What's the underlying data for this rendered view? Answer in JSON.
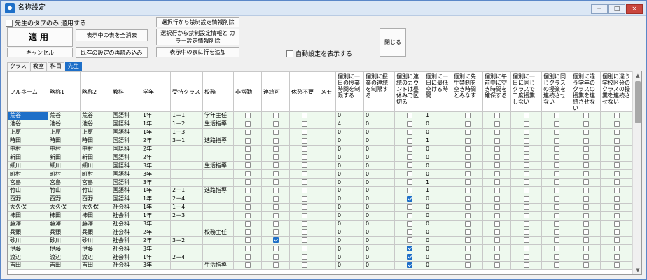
{
  "window": {
    "title": "名称設定",
    "app_icon": "app-icon",
    "minimize": "─",
    "maximize": "□",
    "close": "×"
  },
  "controls": {
    "apply_other_tabs": "先生のタブのみ 適用する",
    "apply": "適用",
    "cancel": "キャンセル",
    "clear_table": "表示中の表を全消去",
    "reload_settings": "既存の設定の再読み込み",
    "delete_restriction": "選択行から禁制設定情報削除",
    "delete_restriction_color": "選択行から禁制設定情報と カラー設定情報削除",
    "add_row": "表示中の表に行を追加",
    "auto_settings": "自動設定を表示する",
    "close": "閉じる"
  },
  "tabs": [
    {
      "label": "クラス",
      "active": false
    },
    {
      "label": "教室",
      "active": false
    },
    {
      "label": "科目",
      "active": false
    },
    {
      "label": "先生",
      "active": true
    }
  ],
  "columns": [
    "フルネーム",
    "略称1",
    "略称2",
    "教科",
    "学年",
    "受持クラス",
    "校務",
    "非常勤",
    "連続可",
    "休憩不要",
    "メモ",
    "個別に一日の授業時間を制限する",
    "個別に授業の連続を制限する",
    "個別に連続のカウントは昼休みで区切る",
    "個別に一日に最低空ける時間",
    "個別に先生禁制を空き時間とみなす",
    "個別に午前中に空き時間を確保する",
    "個別に一日に同じクラスで二度授業しない",
    "個別に同じクラスの授業を連続させない",
    "個別に違う学年のクラスの授業を連続させない",
    "個別に違う学校区分のクラスの授業を連続させない"
  ],
  "rows": [
    {
      "fullname": "荒谷",
      "short1": "荒谷",
      "short2": "荒谷",
      "subject": "国語科",
      "grade": "1年",
      "class": "1－1",
      "duty": "学年主任",
      "c1": "0",
      "c2": "0",
      "c4": "1",
      "parttime": false,
      "consec": false,
      "nobreak": false,
      "lunch": false
    },
    {
      "fullname": "池谷",
      "short1": "池谷",
      "short2": "池谷",
      "subject": "国語科",
      "grade": "1年",
      "class": "1－2",
      "duty": "生活指導",
      "c1": "4",
      "c2": "0",
      "c4": "0",
      "parttime": false,
      "consec": false,
      "nobreak": false,
      "lunch": false
    },
    {
      "fullname": "上原",
      "short1": "上原",
      "short2": "上原",
      "subject": "国語科",
      "grade": "1年",
      "class": "1－3",
      "duty": "",
      "c1": "0",
      "c2": "0",
      "c4": "0",
      "parttime": false,
      "consec": false,
      "nobreak": false,
      "lunch": false
    },
    {
      "fullname": "時田",
      "short1": "時田",
      "short2": "時田",
      "subject": "国語科",
      "grade": "2年",
      "class": "3－1",
      "duty": "進路指導",
      "c1": "0",
      "c2": "0",
      "c4": "1",
      "parttime": false,
      "consec": false,
      "nobreak": false,
      "lunch": false
    },
    {
      "fullname": "中村",
      "short1": "中村",
      "short2": "中村",
      "subject": "国語科",
      "grade": "2年",
      "class": "",
      "duty": "",
      "c1": "0",
      "c2": "0",
      "c4": "0",
      "parttime": false,
      "consec": false,
      "nobreak": false,
      "lunch": false
    },
    {
      "fullname": "新田",
      "short1": "新田",
      "short2": "新田",
      "subject": "国語科",
      "grade": "2年",
      "class": "",
      "duty": "",
      "c1": "0",
      "c2": "0",
      "c4": "0",
      "parttime": false,
      "consec": false,
      "nobreak": false,
      "lunch": false
    },
    {
      "fullname": "細川",
      "short1": "細川",
      "short2": "細川",
      "subject": "国語科",
      "grade": "3年",
      "class": "",
      "duty": "生活指導",
      "c1": "0",
      "c2": "0",
      "c4": "0",
      "parttime": false,
      "consec": false,
      "nobreak": false,
      "lunch": false
    },
    {
      "fullname": "町村",
      "short1": "町村",
      "short2": "町村",
      "subject": "国語科",
      "grade": "3年",
      "class": "",
      "duty": "",
      "c1": "0",
      "c2": "0",
      "c4": "0",
      "parttime": false,
      "consec": false,
      "nobreak": false,
      "lunch": false
    },
    {
      "fullname": "宮島",
      "short1": "宮島",
      "short2": "宮島",
      "subject": "国語科",
      "grade": "3年",
      "class": "",
      "duty": "",
      "c1": "0",
      "c2": "0",
      "c4": "1",
      "parttime": false,
      "consec": false,
      "nobreak": false,
      "lunch": false
    },
    {
      "fullname": "竹山",
      "short1": "竹山",
      "short2": "竹山",
      "subject": "国語科",
      "grade": "1年",
      "class": "2－1",
      "duty": "進路指導",
      "c1": "0",
      "c2": "0",
      "c4": "1",
      "parttime": false,
      "consec": false,
      "nobreak": false,
      "lunch": false
    },
    {
      "fullname": "西野",
      "short1": "西野",
      "short2": "西野",
      "subject": "国語科",
      "grade": "1年",
      "class": "2－4",
      "duty": "",
      "c1": "0",
      "c2": "0",
      "c4": "0",
      "parttime": false,
      "consec": false,
      "nobreak": false,
      "lunch": true
    },
    {
      "fullname": "大久保",
      "short1": "大久保",
      "short2": "大久保",
      "subject": "社会科",
      "grade": "1年",
      "class": "1－4",
      "duty": "",
      "c1": "0",
      "c2": "0",
      "c4": "0",
      "parttime": false,
      "consec": false,
      "nobreak": false,
      "lunch": false
    },
    {
      "fullname": "柿田",
      "short1": "柿田",
      "short2": "柿田",
      "subject": "社会科",
      "grade": "1年",
      "class": "2－3",
      "duty": "",
      "c1": "0",
      "c2": "0",
      "c4": "0",
      "parttime": false,
      "consec": false,
      "nobreak": false,
      "lunch": false
    },
    {
      "fullname": "藤澤",
      "short1": "藤澤",
      "short2": "藤澤",
      "subject": "社会科",
      "grade": "3年",
      "class": "",
      "duty": "",
      "c1": "0",
      "c2": "0",
      "c4": "0",
      "parttime": false,
      "consec": false,
      "nobreak": false,
      "lunch": false
    },
    {
      "fullname": "兵頭",
      "short1": "兵頭",
      "short2": "兵頭",
      "subject": "社会科",
      "grade": "2年",
      "class": "",
      "duty": "校務主任",
      "c1": "0",
      "c2": "0",
      "c4": "0",
      "parttime": false,
      "consec": false,
      "nobreak": false,
      "lunch": false
    },
    {
      "fullname": "砂川",
      "short1": "砂川",
      "short2": "砂川",
      "subject": "社会科",
      "grade": "2年",
      "class": "3－2",
      "duty": "",
      "c1": "0",
      "c2": "0",
      "c4": "0",
      "parttime": false,
      "consec": true,
      "nobreak": false,
      "lunch": false
    },
    {
      "fullname": "伊藤",
      "short1": "伊藤",
      "short2": "伊藤",
      "subject": "社会科",
      "grade": "3年",
      "class": "",
      "duty": "",
      "c1": "0",
      "c2": "0",
      "c4": "0",
      "parttime": false,
      "consec": false,
      "nobreak": false,
      "lunch": true
    },
    {
      "fullname": "渡辺",
      "short1": "渡辺",
      "short2": "渡辺",
      "subject": "社会科",
      "grade": "1年",
      "class": "2－4",
      "duty": "",
      "c1": "0",
      "c2": "0",
      "c4": "0",
      "parttime": false,
      "consec": false,
      "nobreak": false,
      "lunch": true
    },
    {
      "fullname": "吉田",
      "short1": "吉田",
      "short2": "吉田",
      "subject": "社会科",
      "grade": "3年",
      "class": "",
      "duty": "生活指導",
      "c1": "0",
      "c2": "0",
      "c4": "0",
      "parttime": false,
      "consec": false,
      "nobreak": false,
      "lunch": true
    }
  ],
  "colors": {
    "accent": "#1e6fc8",
    "row_bg": "#eef9ee"
  }
}
